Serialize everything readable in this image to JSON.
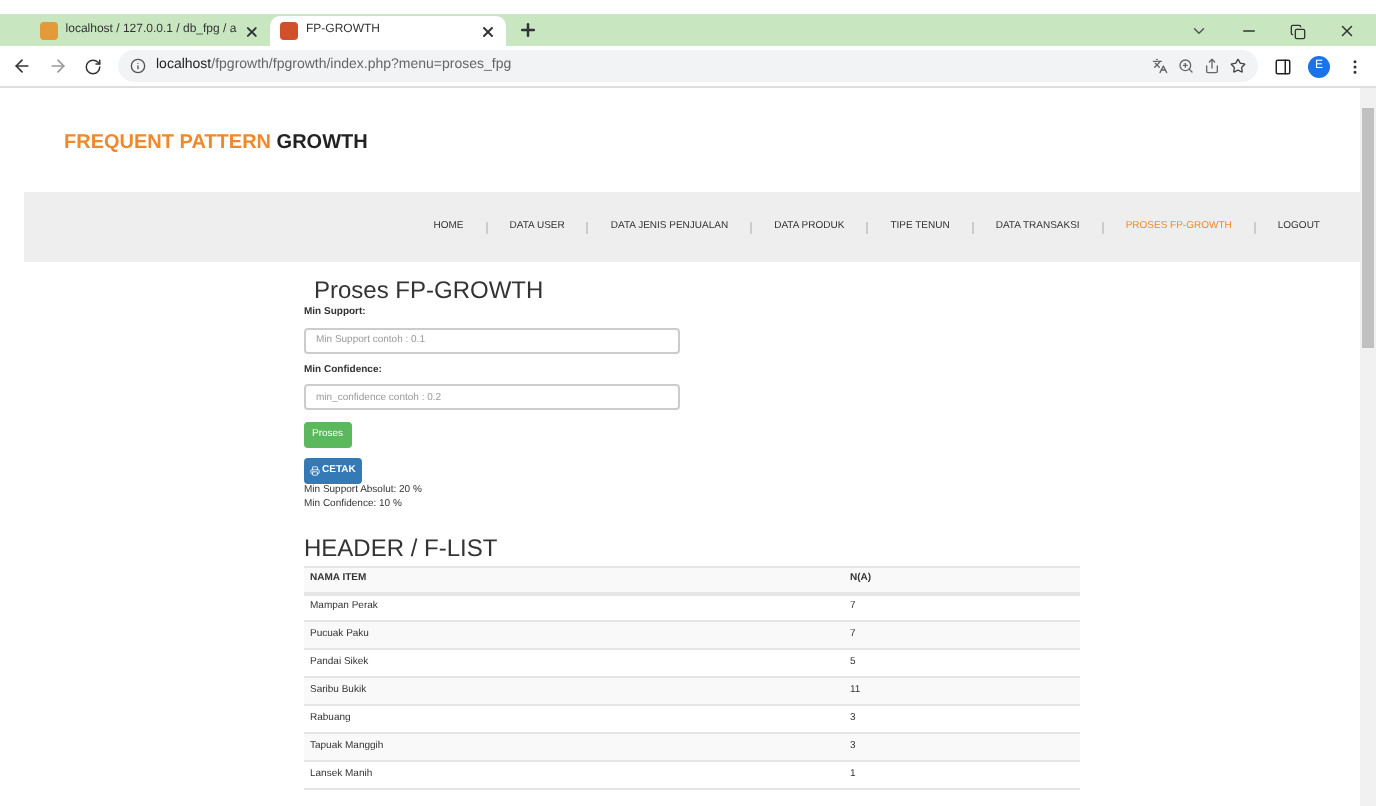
{
  "browser": {
    "tabs": [
      {
        "title": "localhost / 127.0.0.1 / db_fpg / a",
        "selected": false
      },
      {
        "title": "FP-GROWTH",
        "selected": true
      }
    ],
    "url_host": "localhost",
    "url_path": "/fpgrowth/fpgrowth/index.php?menu=proses_fpg",
    "profile_initial": "E"
  },
  "logo": {
    "accent": "FREQUENT PATTERN",
    "rest": "GROWTH"
  },
  "nav": [
    {
      "label": "HOME",
      "selected": false
    },
    {
      "label": "DATA USER",
      "selected": false
    },
    {
      "label": "DATA JENIS PENJUALAN",
      "selected": false
    },
    {
      "label": "DATA PRODUK",
      "selected": false
    },
    {
      "label": "TIPE TENUN",
      "selected": false
    },
    {
      "label": "DATA TRANSAKSI",
      "selected": false
    },
    {
      "label": "PROSES FP-GROWTH",
      "selected": true
    },
    {
      "label": "LOGOUT",
      "selected": false
    }
  ],
  "form": {
    "title": "Proses FP-GROWTH",
    "fields": [
      {
        "label": "Min Support:",
        "placeholder": "Min Support contoh : 0.1"
      },
      {
        "label": "Min Confidence:",
        "placeholder": "min_confidence contoh : 0.2"
      }
    ],
    "submit": "Proses",
    "print": "CETAK",
    "results": [
      "Min Support Absolut: 20 %",
      "Min Confidence: 10 %"
    ]
  },
  "table": {
    "title": "HEADER / F-LIST",
    "columns": [
      "NAMA ITEM",
      "N(A)"
    ],
    "rows": [
      [
        "Mampan Perak",
        "7"
      ],
      [
        "Pucuak Paku",
        "7"
      ],
      [
        "Pandai Sikek",
        "5"
      ],
      [
        "Saribu Bukik",
        "11"
      ],
      [
        "Rabuang",
        "3"
      ],
      [
        "Tapuak Manggih",
        "3"
      ],
      [
        "Lansek Manih",
        "1"
      ]
    ]
  }
}
